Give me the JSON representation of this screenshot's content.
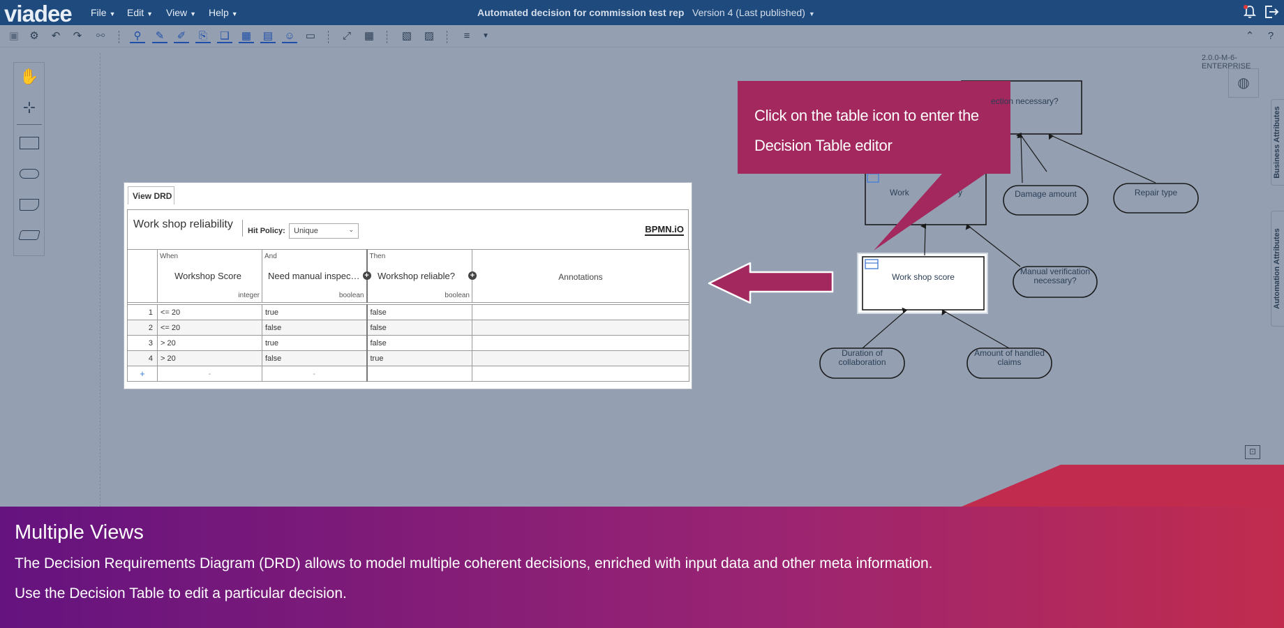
{
  "app": {
    "logo": "viadee",
    "menus": [
      {
        "label": "File"
      },
      {
        "label": "Edit"
      },
      {
        "label": "View"
      },
      {
        "label": "Help"
      }
    ],
    "document_title": "Automated decision for commission test rep",
    "version_label": "Version 4 (Last published)",
    "build_version": "2.0.0-M-6-ENTERPRISE"
  },
  "side_tabs": {
    "business": "Business Attributes",
    "automation": "Automation Attributes"
  },
  "decision_table": {
    "view_drd_tab": "View DRD",
    "name": "Work shop reliability",
    "hit_policy_label": "Hit Policy:",
    "hit_policy_value": "Unique",
    "bpmn_logo": "BPMN.iO",
    "columns": [
      {
        "clause": "When",
        "label": "Workshop Score",
        "type": "integer"
      },
      {
        "clause": "And",
        "label": "Need manual inspection?",
        "type": "boolean"
      },
      {
        "clause": "Then",
        "label": "Workshop reliable?",
        "type": "boolean"
      }
    ],
    "annotations_label": "Annotations",
    "rows": [
      {
        "num": "1",
        "c1": "<= 20",
        "c2": "true",
        "c3": "false"
      },
      {
        "num": "2",
        "c1": "<= 20",
        "c2": "false",
        "c3": "false"
      },
      {
        "num": "3",
        "c1": "> 20",
        "c2": "true",
        "c3": "false"
      },
      {
        "num": "4",
        "c1": "> 20",
        "c2": "false",
        "c3": "true"
      }
    ],
    "add_row": {
      "plus": "+",
      "dash1": "-",
      "dash2": "-"
    }
  },
  "drd": {
    "decision_top": "ection necessary?",
    "decision_reliability": "Work",
    "decision_reliability_suffix": "y",
    "decision_score": "Work shop score",
    "input_damage": "Damage amount",
    "input_repair": "Repair type",
    "input_manual_line1": "Manual verification",
    "input_manual_line2": "necessary?",
    "input_duration_line1": "Duration of",
    "input_duration_line2": "collaboration",
    "input_claims_line1": "Amount of handled",
    "input_claims_line2": "claims"
  },
  "callout": {
    "line1": "Click on the table icon to enter the",
    "line2": "Decision Table editor"
  },
  "banner": {
    "title": "Multiple Views",
    "line1": "The Decision Requirements Diagram (DRD) allows to model multiple coherent decisions, enriched with input data and other meta information.",
    "line2": "Use the Decision Table to edit a particular decision."
  },
  "colors": {
    "topbar": "#1e4a7e",
    "canvas": "#94a0b2",
    "callout": "#a3285e",
    "banner_start": "#65137f",
    "banner_end": "#c12c4e"
  }
}
